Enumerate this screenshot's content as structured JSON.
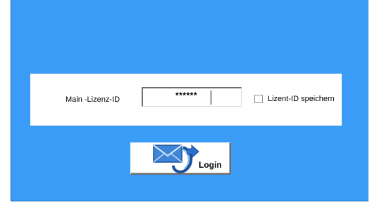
{
  "login": {
    "id_label": "Main -Lizenz-ID",
    "id_value": "******",
    "remember_label": "Lizent-ID speichern",
    "remember_checked": false,
    "button_label": "Login"
  },
  "icons": {
    "login": "envelope-arrow-icon",
    "checkbox": "checkbox-icon"
  },
  "colors": {
    "background": "#3a9cf6",
    "panel": "#ffffff"
  }
}
